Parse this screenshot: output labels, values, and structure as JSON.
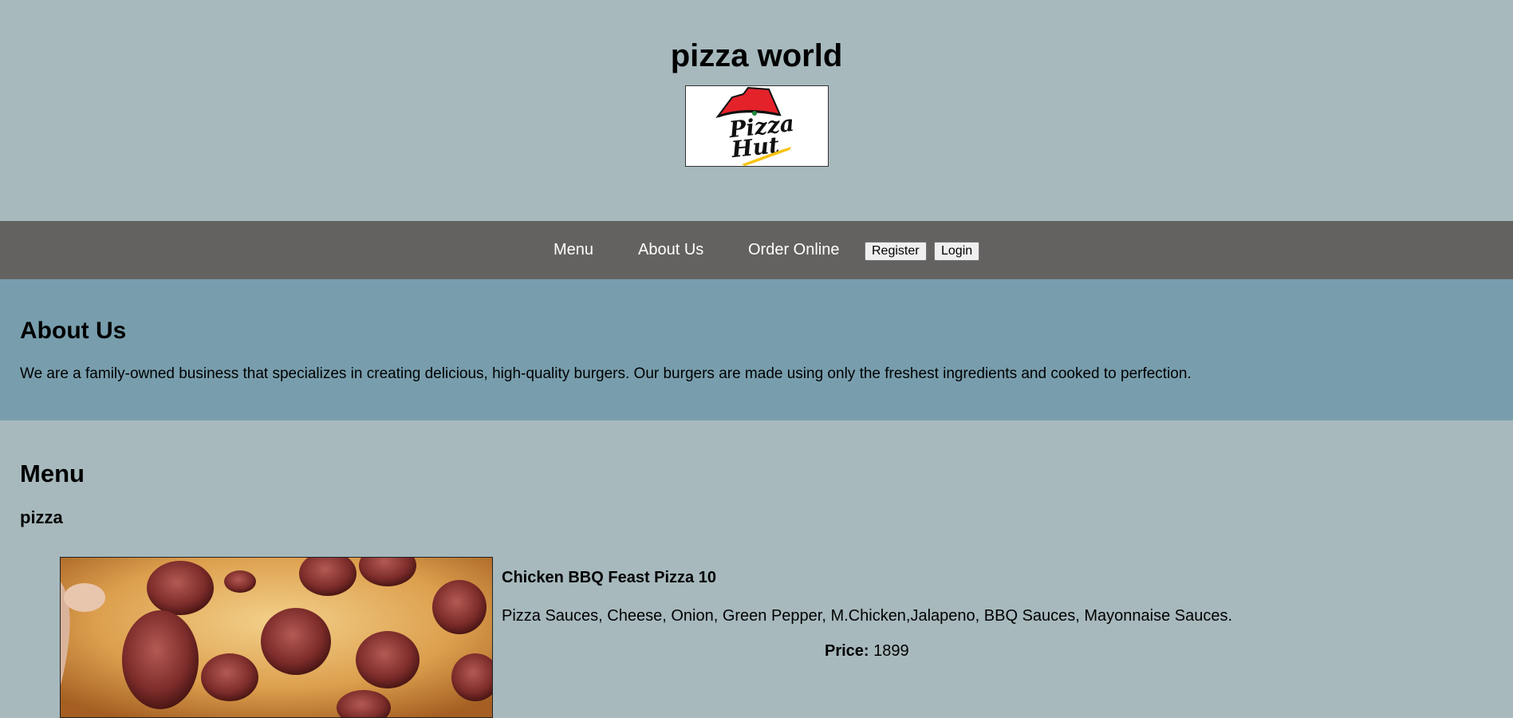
{
  "header": {
    "site_title": "pizza world",
    "logo_text_1": "Pizza",
    "logo_text_2": "Hut"
  },
  "nav": {
    "links": [
      "Menu",
      "About Us",
      "Order Online"
    ],
    "register_label": "Register",
    "login_label": "Login"
  },
  "about": {
    "title": "About Us",
    "text": "We are a family-owned business that specializes in creating delicious, high-quality burgers. Our burgers are made using only the freshest ingredients and cooked to perfection."
  },
  "menu": {
    "title": "Menu",
    "category": "pizza",
    "items": [
      {
        "name": "Chicken BBQ Feast Pizza 10",
        "description": "Pizza Sauces, Cheese, Onion, Green Pepper, M.Chicken,Jalapeno, BBQ Sauces, Mayonnaise Sauces.",
        "price_label": "Price:",
        "price": "1899"
      }
    ]
  },
  "colors": {
    "page_bg": "#a7b9bd",
    "nav_bg": "#646261",
    "about_bg": "#789ead"
  }
}
